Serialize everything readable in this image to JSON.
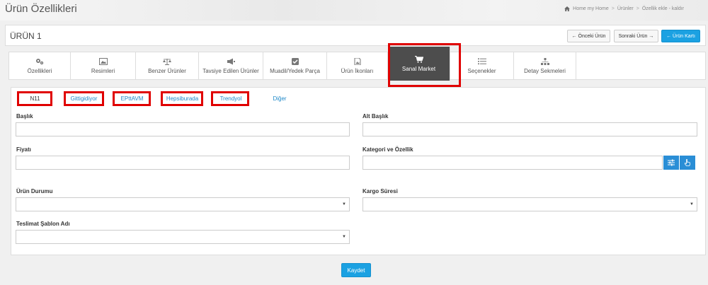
{
  "page": {
    "title": "Ürün Özellikleri",
    "breadcrumb": [
      "Home my Home",
      "Ürünler",
      "Özellik ekle - kaldır"
    ]
  },
  "product": {
    "title": "ÜRÜN 1",
    "prev_button": "← Önceki Ürün",
    "next_button": "Sonraki Ürün →",
    "card_button": "← Ürün Kartı"
  },
  "tabs": [
    {
      "label": "Özellikleri",
      "icon": "gears-icon"
    },
    {
      "label": "Resimleri",
      "icon": "image-icon"
    },
    {
      "label": "Benzer Ürünler",
      "icon": "balance-scale-icon"
    },
    {
      "label": "Tavsiye Edilen Ürünler",
      "icon": "megaphone-icon"
    },
    {
      "label": "Muadil/Yedek Parça",
      "icon": "check-square-icon"
    },
    {
      "label": "Ürün İkonları",
      "icon": "file-image-icon"
    },
    {
      "label": "Sanal Market",
      "icon": "shopping-cart-icon",
      "active": true
    },
    {
      "label": "Seçenekler",
      "icon": "list-icon"
    },
    {
      "label": "Detay Sekmeleri",
      "icon": "sitemap-icon"
    }
  ],
  "subtabs": [
    "N11",
    "Gittigidiyor",
    "EPttAVM",
    "Hepsiburada",
    "Trendyol",
    "Diğer"
  ],
  "form": {
    "baslik_label": "Başlık",
    "alt_baslik_label": "Alt Başlık",
    "fiyati_label": "Fiyatı",
    "kategori_label": "Kategori ve Özellik",
    "urun_durumu_label": "Ürün Durumu",
    "kargo_suresi_label": "Kargo Süresi",
    "teslimat_label": "Teslimat Şablon Adı",
    "baslik_value": "",
    "alt_baslik_value": "",
    "fiyati_value": "",
    "kategori_value": ""
  },
  "save_label": "Kaydet",
  "colors": {
    "primary": "#1ba1e2",
    "active_tab": "#4d4d4d",
    "highlight": "#e00000",
    "link": "#1e88c8"
  }
}
